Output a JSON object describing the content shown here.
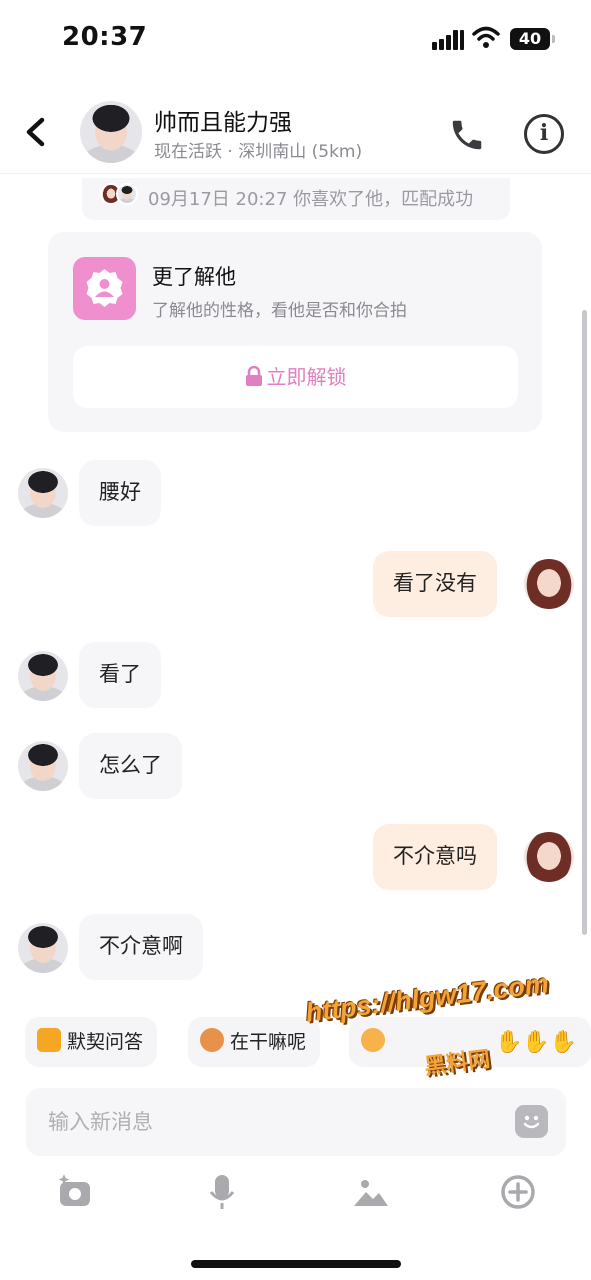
{
  "status_bar": {
    "time": "20:37",
    "battery": "40"
  },
  "header": {
    "name": "帅而且能力强",
    "subtitle": "现在活跃 · 深圳南山 (5km)"
  },
  "match": {
    "text": "09月17日 20:27 你喜欢了他，匹配成功"
  },
  "card": {
    "title": "更了解他",
    "desc": "了解他的性格，看他是否和你合拍",
    "unlock_label": "立即解锁"
  },
  "messages": [
    {
      "from": "them",
      "text": "腰好"
    },
    {
      "from": "me",
      "text": "看了没有"
    },
    {
      "from": "them",
      "text": "看了"
    },
    {
      "from": "them",
      "text": "怎么了"
    },
    {
      "from": "me",
      "text": "不介意吗"
    },
    {
      "from": "them",
      "text": "不介意啊"
    }
  ],
  "quick_replies": [
    "默契问答",
    "在干嘛呢"
  ],
  "watermark": {
    "line1": "https://hlgw17.com",
    "line2": "黑料网"
  },
  "input": {
    "placeholder": "输入新消息"
  },
  "colors": {
    "accent": "#f08fce",
    "incoming_bubble": "#f6f6f8",
    "outgoing_bubble": "#fdeee1"
  }
}
